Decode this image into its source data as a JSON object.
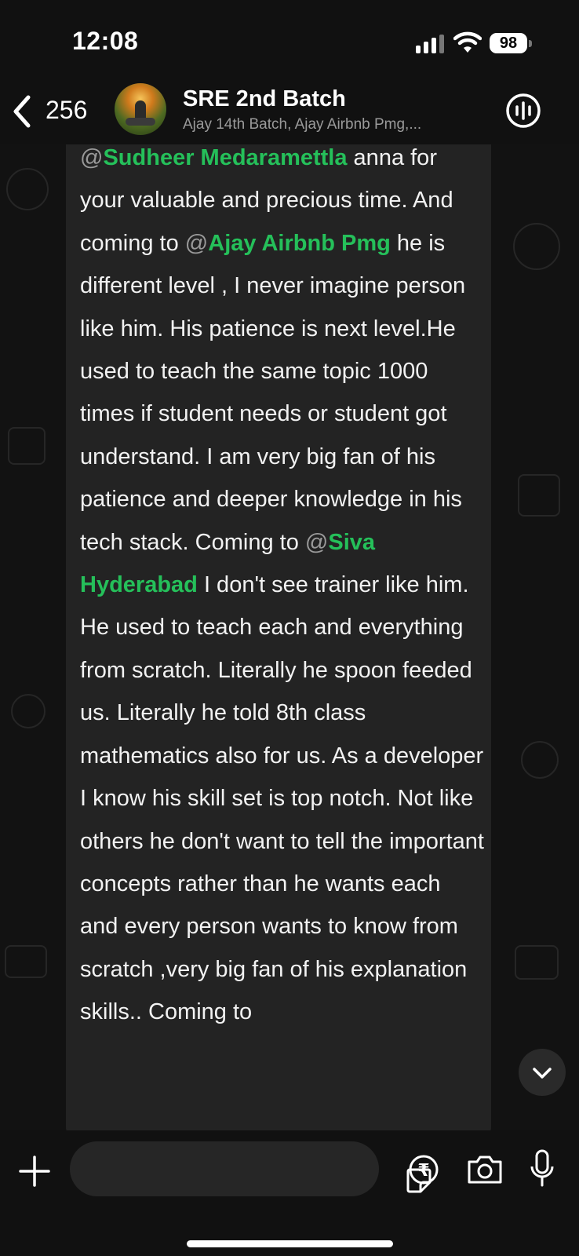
{
  "status_bar": {
    "time": "12:08",
    "battery": "98"
  },
  "header": {
    "back_count": "256",
    "title": "SRE 2nd Batch",
    "subtitle": "Ajay 14th Batch, Ajay Airbnb Pmg,..."
  },
  "message": {
    "segments": [
      {
        "type": "mention",
        "text": "Sudheer Medaramettla"
      },
      {
        "type": "text",
        "text": " anna for your valuable and precious time. And coming to "
      },
      {
        "type": "mention",
        "text": "Ajay Airbnb Pmg"
      },
      {
        "type": "text",
        "text": " he is different level , I never imagine person like him. His patience is next level.He used to teach the same topic 1000 times if student needs or student got understand. I am very big fan of his patience and deeper knowledge in his tech stack. Coming to "
      },
      {
        "type": "mention",
        "text": "Siva Hyderabad"
      },
      {
        "type": "text",
        "text": " I don't see trainer like him. He used to teach each and everything from scratch. Literally he spoon feeded us. Literally he told 8th class mathematics also for us. As a developer I know his skill set is top notch. Not like others he don't want to tell the important concepts rather than he wants each and every person wants to know from scratch ,very big fan of his explanation skills.. Coming to"
      }
    ]
  },
  "input": {
    "placeholder": "",
    "value": ""
  },
  "colors": {
    "mention": "#25c05a",
    "bubble": "#232323",
    "background": "#121212"
  },
  "icons": [
    "back-chevron-icon",
    "voice-call-waveform-icon",
    "chevron-down-icon",
    "plus-icon",
    "sticker-icon",
    "rupee-icon",
    "camera-icon",
    "microphone-icon"
  ]
}
